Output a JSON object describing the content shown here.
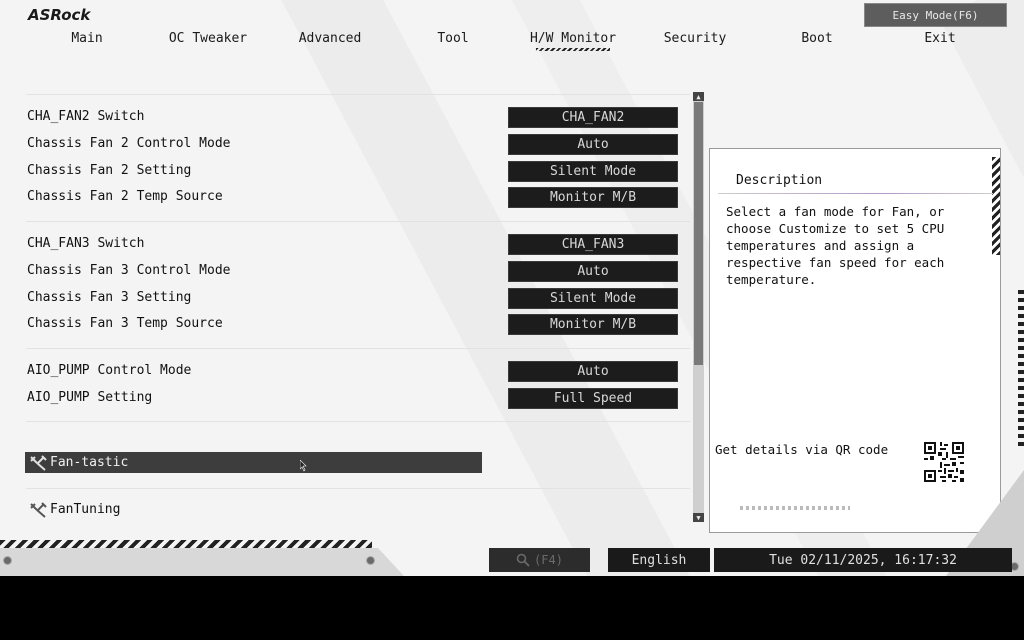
{
  "header": {
    "logo": "ASRock",
    "easy_mode_label": "Easy Mode(F6)"
  },
  "menu": [
    {
      "label": "Main",
      "active": false
    },
    {
      "label": "OC Tweaker",
      "active": false
    },
    {
      "label": "Advanced",
      "active": false
    },
    {
      "label": "Tool",
      "active": false
    },
    {
      "label": "H/W Monitor",
      "active": true
    },
    {
      "label": "Security",
      "active": false
    },
    {
      "label": "Boot",
      "active": false
    },
    {
      "label": "Exit",
      "active": false
    }
  ],
  "settings": [
    {
      "label": "CHA_FAN2 Switch",
      "value": "CHA_FAN2"
    },
    {
      "label": "Chassis Fan 2 Control Mode",
      "value": "Auto"
    },
    {
      "label": "Chassis Fan 2 Setting",
      "value": "Silent Mode"
    },
    {
      "label": "Chassis Fan 2 Temp Source",
      "value": "Monitor M/B"
    },
    {
      "label": "CHA_FAN3 Switch",
      "value": "CHA_FAN3"
    },
    {
      "label": "Chassis Fan 3 Control Mode",
      "value": "Auto"
    },
    {
      "label": "Chassis Fan 3 Setting",
      "value": "Silent Mode"
    },
    {
      "label": "Chassis Fan 3 Temp Source",
      "value": "Monitor M/B"
    },
    {
      "label": "AIO_PUMP Control Mode",
      "value": "Auto"
    },
    {
      "label": "AIO_PUMP Setting",
      "value": "Full Speed"
    }
  ],
  "submenus": {
    "fantastic": "Fan-tastic",
    "fantuning": "FanTuning"
  },
  "description": {
    "title": "Description",
    "body": "Select a fan mode for Fan, or choose Customize to set 5 CPU temperatures and assign a respective fan speed for each temperature.",
    "qr_label": "Get details via QR code"
  },
  "footer": {
    "search_label": "(F4)",
    "language": "English",
    "datetime": "Tue 02/11/2025, 16:17:32"
  },
  "icons": {
    "wrench": "wrench-icon",
    "search": "search-icon",
    "qr": "qr-code-icon"
  }
}
